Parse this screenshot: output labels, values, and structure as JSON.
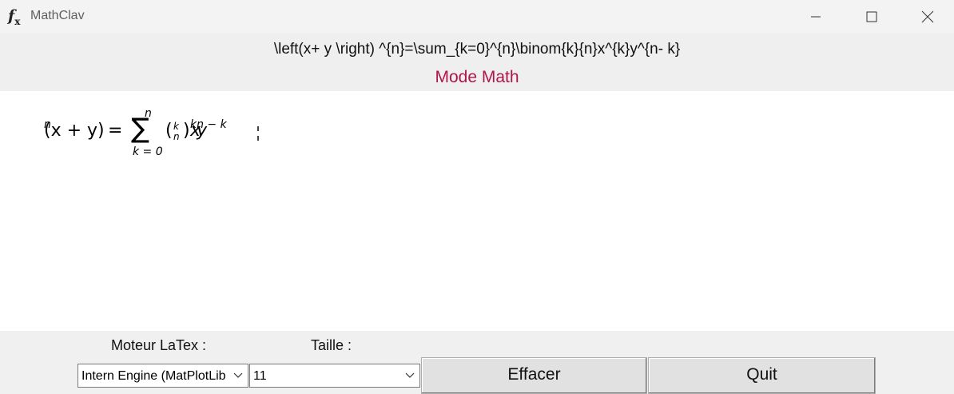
{
  "window": {
    "icon": "function-fx-icon",
    "title": "MathClav",
    "controls": [
      "minimize-icon",
      "maximize-icon",
      "close-icon"
    ]
  },
  "header": {
    "latex_source": "\\left(x+ y \\right) ^{n}=\\sum_{k=0}^{n}\\binom{k}{n}x^{k}y^{n- k}",
    "mode_label": "Mode Math"
  },
  "render": {
    "lhs_base": "(x + y)",
    "lhs_exp": "n",
    "eq": "=",
    "sum_symbol": "∑",
    "sum_upper": "n",
    "sum_lower": "k = 0",
    "binom_top": "k",
    "binom_bottom": "n",
    "x_var": "x",
    "x_exp": "k",
    "y_var": "y",
    "y_exp": "n − k"
  },
  "controls": {
    "engine_label": "Moteur LaTex :",
    "engine_value": "Intern Engine (MatPlotLib)",
    "size_label": "Taille :",
    "size_value": "11",
    "clear_button": "Effacer",
    "quit_button": "Quit"
  },
  "colors": {
    "mode_accent": "#b0154d",
    "canvas_bg": "#ffffff",
    "chrome_bg": "#f0f0f0"
  }
}
